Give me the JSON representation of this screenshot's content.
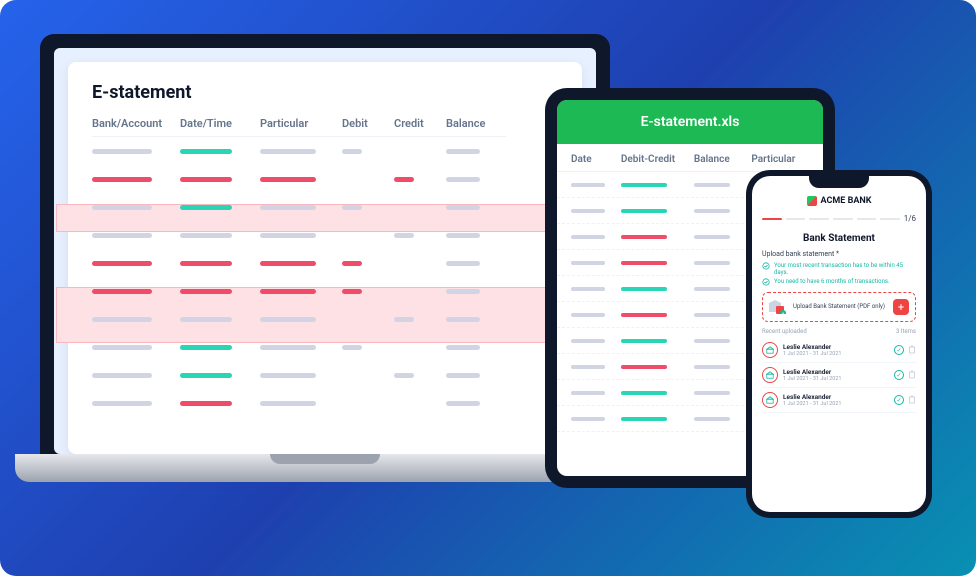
{
  "laptop": {
    "title": "E-statement",
    "columns": [
      "Bank/Account",
      "Date/Time",
      "Particular",
      "Debit",
      "Credit",
      "Balance"
    ],
    "rows": [
      {
        "bank": "g",
        "date": "t",
        "part": "g",
        "debit": "g",
        "credit": "",
        "bal": "g"
      },
      {
        "bank": "r",
        "date": "r",
        "part": "r",
        "debit": "",
        "credit": "r",
        "bal": "g"
      },
      {
        "bank": "g",
        "date": "t",
        "part": "g",
        "debit": "g",
        "credit": "",
        "bal": "g"
      },
      {
        "bank": "g",
        "date": "g",
        "part": "g",
        "debit": "",
        "credit": "g",
        "bal": "g"
      },
      {
        "bank": "r",
        "date": "r",
        "part": "r",
        "debit": "r",
        "credit": "",
        "bal": "g"
      },
      {
        "bank": "r",
        "date": "r",
        "part": "r",
        "debit": "r",
        "credit": "",
        "bal": "g"
      },
      {
        "bank": "g",
        "date": "g",
        "part": "g",
        "debit": "",
        "credit": "g",
        "bal": "g"
      },
      {
        "bank": "g",
        "date": "t",
        "part": "g",
        "debit": "g",
        "credit": "",
        "bal": "g"
      },
      {
        "bank": "g",
        "date": "t",
        "part": "g",
        "debit": "",
        "credit": "g",
        "bal": "g"
      },
      {
        "bank": "g",
        "date": "r",
        "part": "g",
        "debit": "",
        "credit": "",
        "bal": "g"
      }
    ]
  },
  "tablet": {
    "title": "E-statement.xls",
    "columns": [
      "Date",
      "Debit-Credit",
      "Balance",
      "Particular"
    ],
    "rows": [
      {
        "date": "g",
        "dc": "t",
        "bal": "g",
        "part": "g"
      },
      {
        "date": "g",
        "dc": "t",
        "bal": "g",
        "part": "g"
      },
      {
        "date": "g",
        "dc": "r",
        "bal": "g",
        "part": "g"
      },
      {
        "date": "g",
        "dc": "r",
        "bal": "g",
        "part": "g"
      },
      {
        "date": "g",
        "dc": "t",
        "bal": "g",
        "part": "g"
      },
      {
        "date": "g",
        "dc": "r",
        "bal": "g",
        "part": "g"
      },
      {
        "date": "g",
        "dc": "t",
        "bal": "g",
        "part": "g"
      },
      {
        "date": "g",
        "dc": "r",
        "bal": "g",
        "part": "g"
      },
      {
        "date": "g",
        "dc": "t",
        "bal": "g",
        "part": "g"
      },
      {
        "date": "g",
        "dc": "t",
        "bal": "g",
        "part": "g"
      }
    ]
  },
  "phone": {
    "brand": "ACME BANK",
    "progress": {
      "step": "1/6"
    },
    "title": "Bank Statement",
    "upload_label": "Upload bank statement *",
    "tips": [
      "Your most recent transaction has to be within 45 days.",
      "You need to have 6 months of transactions."
    ],
    "upload_box": "Upload Bank Statement (PDF only)",
    "recent_label": "Recent uploaded",
    "recent_count": "3 Items",
    "files": [
      {
        "name": "Leslie Alexander",
        "date": "1 Jul 2021 - 31 Jul 2021"
      },
      {
        "name": "Leslie Alexander",
        "date": "1 Jul 2021 - 31 Jul 2021"
      },
      {
        "name": "Leslie Alexander",
        "date": "1 Jul 2021 - 31 Jul 2021"
      }
    ]
  }
}
